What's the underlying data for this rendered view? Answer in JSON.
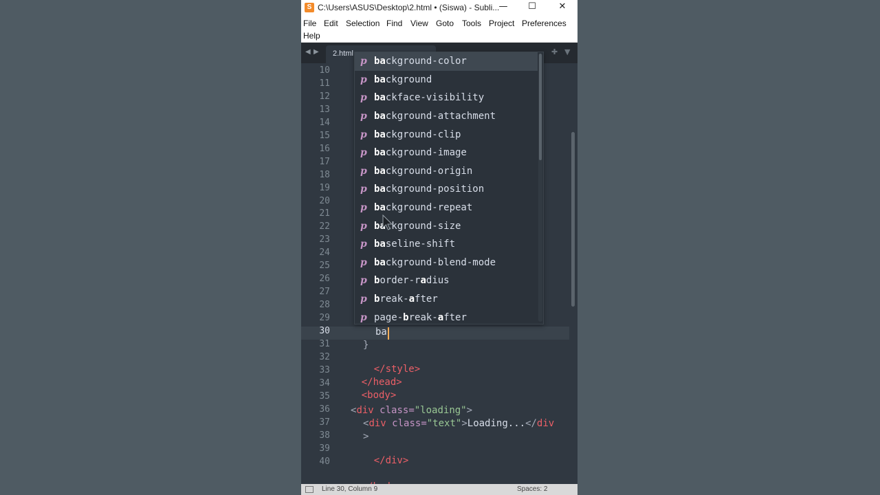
{
  "window": {
    "title": "C:\\Users\\ASUS\\Desktop\\2.html • (Siswa) - Subli...",
    "controls": {
      "minimize": "—",
      "maximize": "☐",
      "close": "✕"
    }
  },
  "menu": [
    "File",
    "Edit",
    "Selection",
    "Find",
    "View",
    "Goto",
    "Tools",
    "Project",
    "Preferences",
    "Help"
  ],
  "tabs": [
    {
      "label": "2.html"
    }
  ],
  "gutter": {
    "lines": [
      "10",
      "11",
      "12",
      "13",
      "14",
      "15",
      "16",
      "17",
      "18",
      "19",
      "20",
      "21",
      "22",
      "23",
      "24",
      "25",
      "26",
      "27",
      "28",
      "29",
      "30",
      "31",
      "32",
      "33",
      "34",
      "35",
      "36",
      "37",
      "38",
      "39",
      "40"
    ],
    "active": "30"
  },
  "code": {
    "line30": "ba",
    "line31_brace": "}",
    "style_close": "</style>",
    "head_close": "</head>",
    "body_open": "<body>",
    "div_open_tag": "div",
    "div_class_attr": "class=",
    "loading_class": "\"loading\"",
    "text_class": "\"text\"",
    "loading_text": "Loading...",
    "div_close": "</div>",
    "body_close": "</body>"
  },
  "autocomplete": {
    "kind_label": "p",
    "items": [
      {
        "bold": "ba",
        "rest": "ckground-color"
      },
      {
        "bold": "ba",
        "rest": "ckground"
      },
      {
        "bold": "ba",
        "rest": "ckface-visibility"
      },
      {
        "bold": "ba",
        "rest": "ckground-attachment"
      },
      {
        "bold": "ba",
        "rest": "ckground-clip"
      },
      {
        "bold": "ba",
        "rest": "ckground-image"
      },
      {
        "bold": "ba",
        "rest": "ckground-origin"
      },
      {
        "bold": "ba",
        "rest": "ckground-position"
      },
      {
        "bold": "ba",
        "rest": "ckground-repeat"
      },
      {
        "bold": "ba",
        "rest": "ckground-size"
      },
      {
        "bold": "ba",
        "rest": "seline-shift"
      },
      {
        "bold": "ba",
        "rest": "ckground-blend-mode"
      },
      {
        "segments": [
          [
            "b",
            1
          ],
          [
            "order-r",
            0
          ],
          [
            "a",
            1
          ],
          [
            "dius",
            0
          ]
        ]
      },
      {
        "segments": [
          [
            "b",
            1
          ],
          [
            "reak-",
            0
          ],
          [
            "a",
            1
          ],
          [
            "fter",
            0
          ]
        ]
      },
      {
        "segments": [
          [
            "page-",
            0
          ],
          [
            "b",
            1
          ],
          [
            "reak-",
            0
          ],
          [
            "a",
            1
          ],
          [
            "fter",
            0
          ]
        ]
      }
    ],
    "selected_index": 0
  },
  "status": {
    "position": "Line 30, Column 9",
    "indent": "Spaces: 2"
  },
  "colors": {
    "background": "#303841",
    "tag": "#ec5f67",
    "attr": "#c594c5",
    "string": "#99c794",
    "caret": "#f9ae58"
  }
}
